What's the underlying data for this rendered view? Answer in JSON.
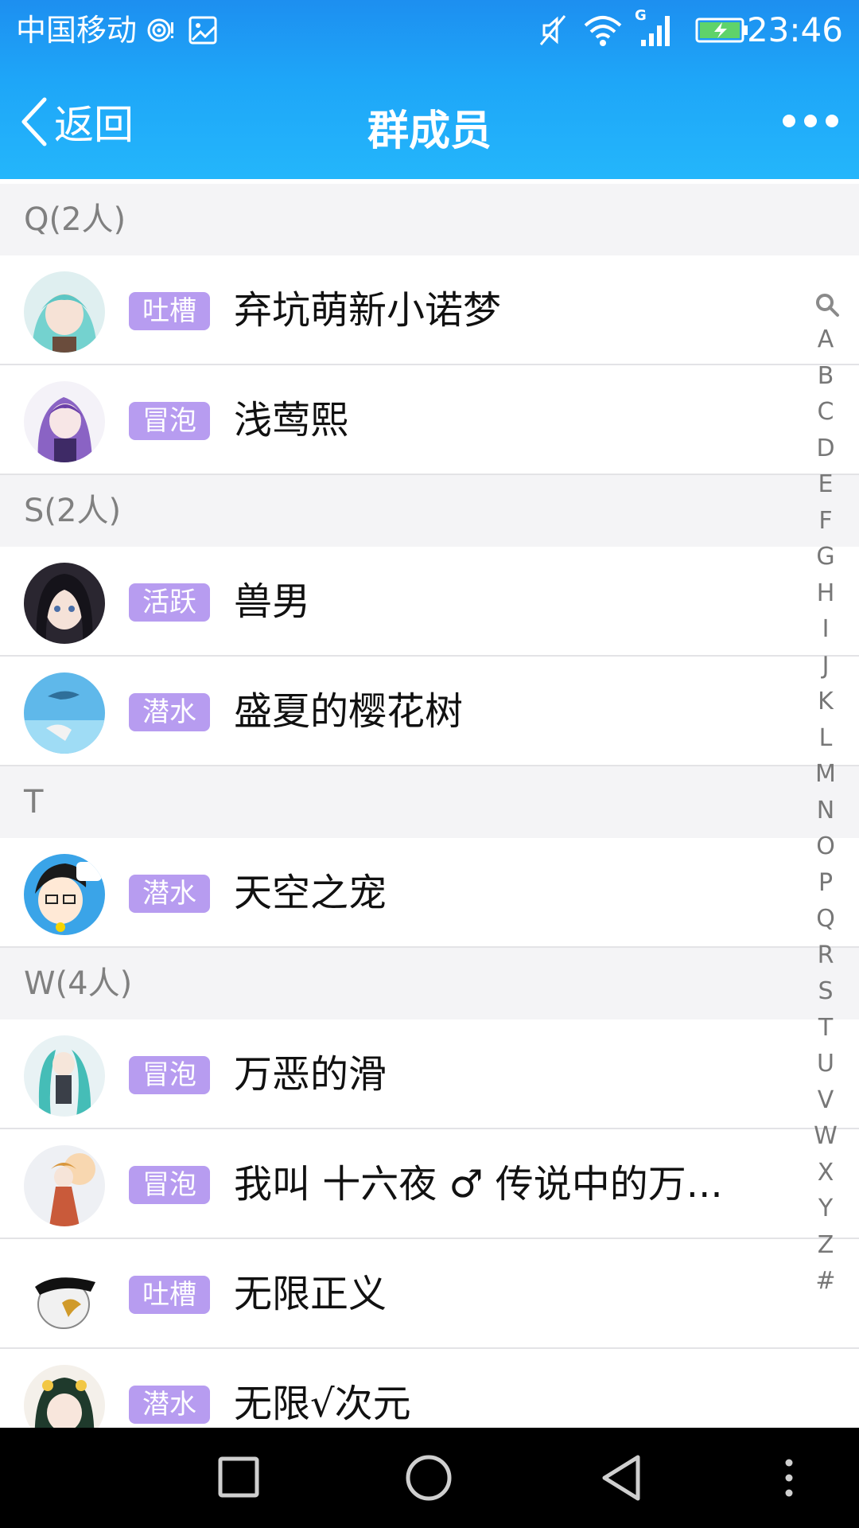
{
  "status_bar": {
    "carrier": "中国移动",
    "network_type": "G",
    "time": "23:46",
    "icons": [
      "hotspot-icon",
      "image-notification-icon",
      "mute-icon",
      "wifi-icon",
      "signal-icon",
      "battery-charging-icon"
    ]
  },
  "nav": {
    "back_label": "返回",
    "title": "群成员",
    "more_icon": "more-dots-icon"
  },
  "groups": [
    {
      "header": "Q(2人)",
      "members": [
        {
          "badge": "吐槽",
          "name": "弃坑萌新小诺梦"
        },
        {
          "badge": "冒泡",
          "name": "浅莺熙"
        }
      ]
    },
    {
      "header": "S(2人)",
      "members": [
        {
          "badge": "活跃",
          "name": "兽男"
        },
        {
          "badge": "潜水",
          "name": "盛夏的樱花树"
        }
      ]
    },
    {
      "header": "T",
      "members": [
        {
          "badge": "潜水",
          "name": "天空之宠"
        }
      ]
    },
    {
      "header": "W(4人)",
      "members": [
        {
          "badge": "冒泡",
          "name": "万恶的滑"
        },
        {
          "badge": "冒泡",
          "name": "我叫  十六夜 ♂  传说中的万..."
        },
        {
          "badge": "吐槽",
          "name": "无限正义"
        },
        {
          "badge": "潜水",
          "name": "无限√次元"
        }
      ]
    }
  ],
  "index_bar": [
    "search-icon",
    "A",
    "B",
    "C",
    "D",
    "E",
    "F",
    "G",
    "H",
    "I",
    "J",
    "K",
    "L",
    "M",
    "N",
    "O",
    "P",
    "Q",
    "R",
    "S",
    "T",
    "U",
    "V",
    "W",
    "X",
    "Y",
    "Z",
    "#"
  ],
  "system_nav": [
    "recents-square-icon",
    "home-circle-icon",
    "back-triangle-icon",
    "menu-dots-icon"
  ],
  "colors": {
    "header_gradient_top": "#1d8ff0",
    "header_gradient_bottom": "#24b6fb",
    "badge": "#b79cf0",
    "group_header_bg": "#f4f4f6",
    "group_header_text": "#808080"
  }
}
